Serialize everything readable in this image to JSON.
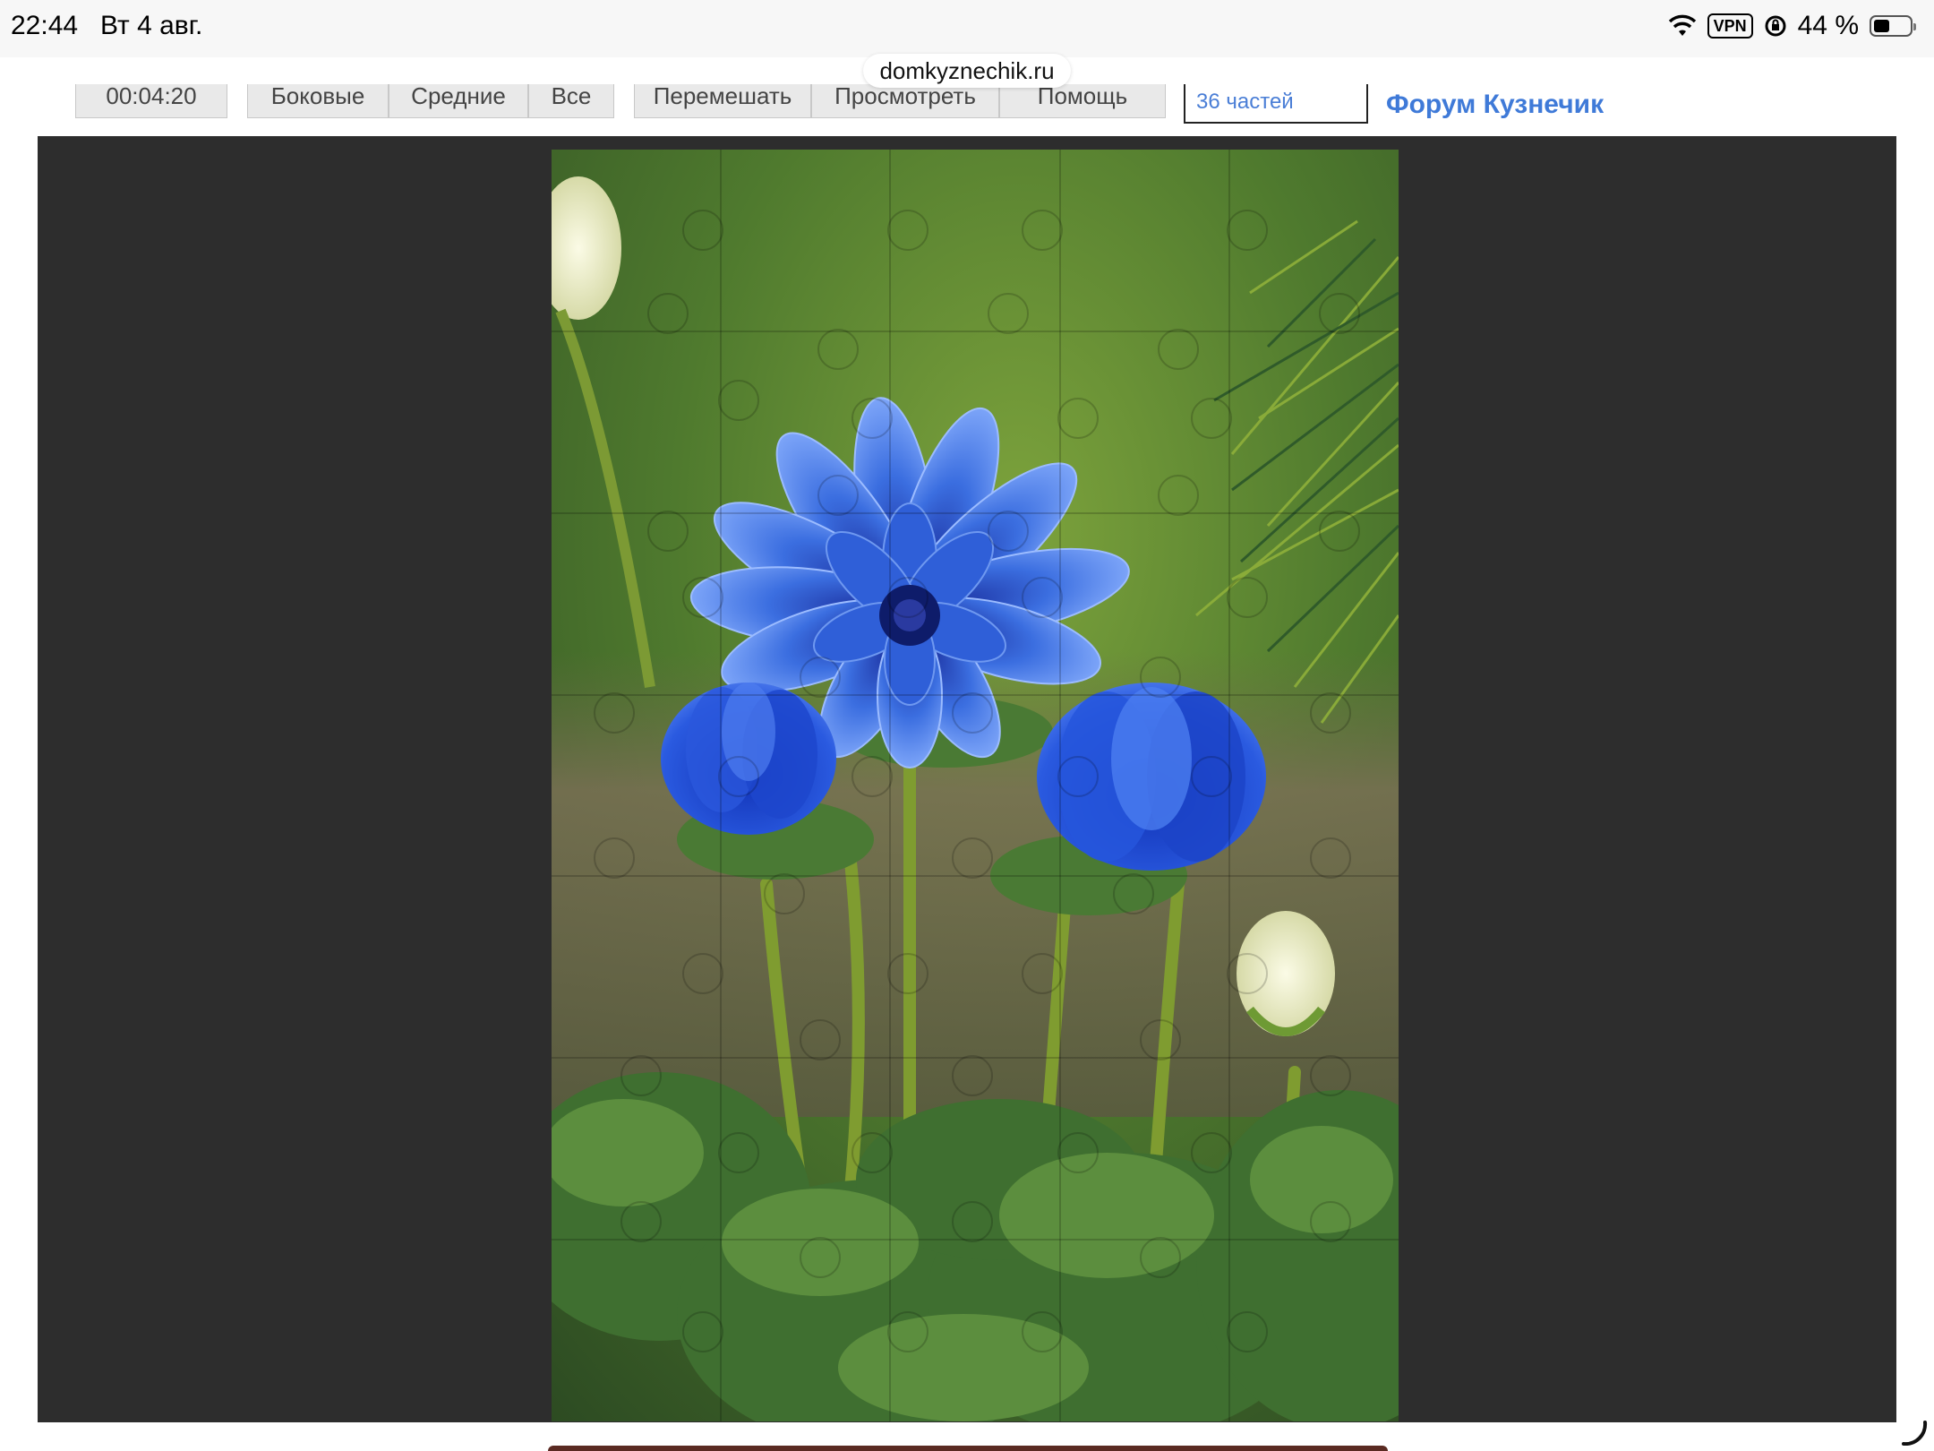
{
  "status_bar": {
    "time": "22:44",
    "date": "Вт 4 авг.",
    "vpn": "VPN",
    "battery": "44 %",
    "battery_level": 0.44
  },
  "browser": {
    "url": "domkyznechik.ru"
  },
  "toolbar": {
    "timer": "00:04:20",
    "buttons": [
      "Боковые",
      "Средние",
      "Все",
      "Перемешать",
      "Просмотреть",
      "Помощь"
    ],
    "pieces_select": "36 частей",
    "forum_link": "Форум Кузнечик"
  },
  "puzzle": {
    "image": "blue anemone flowers",
    "columns": 5,
    "rows": 7,
    "colors": {
      "board": "#2d2d2d",
      "petal": "#3d6fe0",
      "petal_dark": "#1c3fb8",
      "leaf": "#3f6e32",
      "stem": "#7a9a2e"
    }
  }
}
